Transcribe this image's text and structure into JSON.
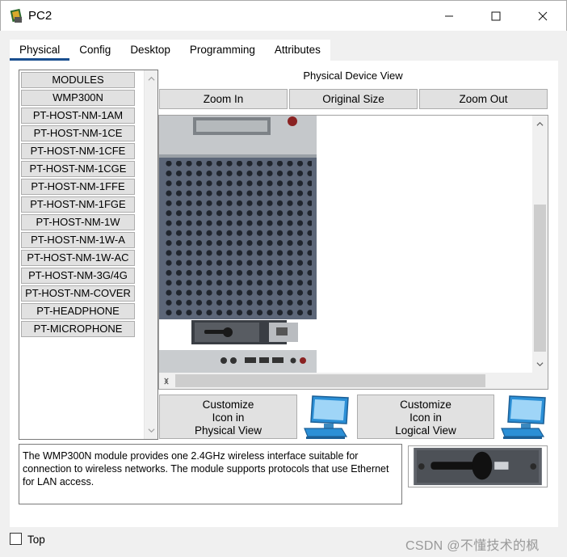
{
  "window": {
    "title": "PC2",
    "minimize_glyph": "—",
    "maximize_glyph": "☐",
    "close_glyph": "✕"
  },
  "tabs": [
    {
      "label": "Physical",
      "active": true
    },
    {
      "label": "Config",
      "active": false
    },
    {
      "label": "Desktop",
      "active": false
    },
    {
      "label": "Programming",
      "active": false
    },
    {
      "label": "Attributes",
      "active": false
    }
  ],
  "modules": {
    "items": [
      "MODULES",
      "WMP300N",
      "PT-HOST-NM-1AM",
      "PT-HOST-NM-1CE",
      "PT-HOST-NM-1CFE",
      "PT-HOST-NM-1CGE",
      "PT-HOST-NM-1FFE",
      "PT-HOST-NM-1FGE",
      "PT-HOST-NM-1W",
      "PT-HOST-NM-1W-A",
      "PT-HOST-NM-1W-AC",
      "PT-HOST-NM-3G/4G",
      "PT-HOST-NM-COVER",
      "PT-HEADPHONE",
      "PT-MICROPHONE"
    ]
  },
  "physical_view": {
    "label": "Physical Device View",
    "zoom_in": "Zoom In",
    "original_size": "Original Size",
    "zoom_out": "Zoom Out"
  },
  "customize": {
    "physical_line1": "Customize",
    "physical_line2": "Icon in",
    "physical_line3": "Physical View",
    "logical_line1": "Customize",
    "logical_line2": "Icon in",
    "logical_line3": "Logical View"
  },
  "description": "The WMP300N module provides one 2.4GHz wireless interface suitable for connection to wireless networks. The module supports protocols that use Ethernet for LAN access.",
  "footer": {
    "top_label": "Top",
    "watermark": "CSDN @不懂技术的枫"
  },
  "colors": {
    "accent": "#1a4f8f",
    "device_panel": "#5c6678",
    "button_bg": "#e1e1e1"
  }
}
